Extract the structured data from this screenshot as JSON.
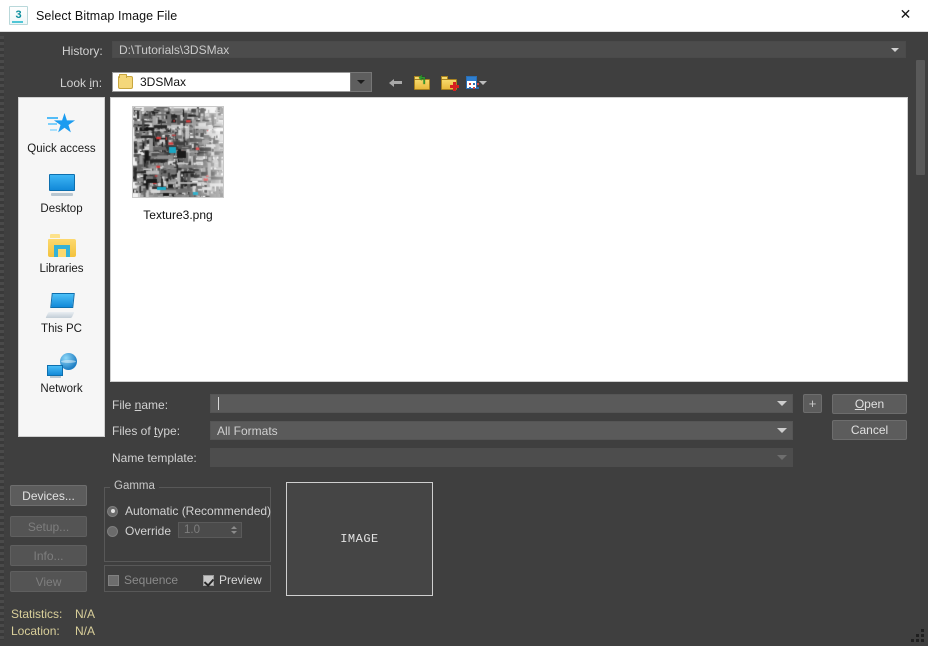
{
  "window": {
    "title": "Select Bitmap Image File",
    "app_icon": "3dsmax-icon",
    "icon_glyph": "3",
    "close_label": "✕"
  },
  "top": {
    "history_label": "History:",
    "history_value": "D:\\Tutorials\\3DSMax",
    "lookin_label_pre": "Look ",
    "lookin_label_mnemonic": "i",
    "lookin_label_post": "n:",
    "lookin_value": "3DSMax",
    "toolbar": {
      "back": "back-arrow-icon",
      "up": "up-one-level-icon",
      "new_folder": "create-new-folder-icon",
      "views": "change-view-icon",
      "up_glyph": "↰"
    }
  },
  "places": {
    "items": [
      {
        "label": "Quick access",
        "icon": "quick-access-star-icon"
      },
      {
        "label": "Desktop",
        "icon": "desktop-monitor-icon"
      },
      {
        "label": "Libraries",
        "icon": "libraries-folder-icon"
      },
      {
        "label": "This PC",
        "icon": "this-pc-icon"
      },
      {
        "label": "Network",
        "icon": "network-globe-icon"
      }
    ]
  },
  "filelist": {
    "files": [
      {
        "name": "Texture3.png",
        "icon": "image-thumbnail"
      }
    ]
  },
  "fields": {
    "filename_label_pre": "File ",
    "filename_label_mnemonic": "n",
    "filename_label_post": "ame:",
    "filename_value": "",
    "filetype_label_pre": "Files of ",
    "filetype_label_mnemonic": "t",
    "filetype_label_post": "ype:",
    "filetype_value": "All Formats",
    "nametemplate_label": "Name template:",
    "nametemplate_value": ""
  },
  "buttons": {
    "plus": "+",
    "open_mnemonic": "O",
    "open_rest": "pen",
    "cancel": "Cancel",
    "devices": "Devices...",
    "setup": "Setup...",
    "info": "Info...",
    "view": "View"
  },
  "status": {
    "statistics_label": "Statistics:",
    "statistics_value": "N/A",
    "location_label": "Location:",
    "location_value": "N/A"
  },
  "gamma": {
    "title": "Gamma",
    "automatic_label": "Automatic (Recommended)",
    "automatic_selected": true,
    "override_label": "Override",
    "override_selected": false,
    "override_value": "1.0",
    "sequence_label": "Sequence",
    "sequence_checked": false,
    "preview_label": "Preview",
    "preview_checked": true
  },
  "preview": {
    "placeholder": "IMAGE"
  },
  "colors": {
    "dialog_bg": "#3f3f3f",
    "titlebar_bg": "#ffffff",
    "field_bg": "#5a5a5a",
    "button_bg": "#5c5c5c",
    "list_bg": "#ffffff",
    "status_text": "#d9cf9a",
    "accent_blue": "#1b9cf0"
  }
}
